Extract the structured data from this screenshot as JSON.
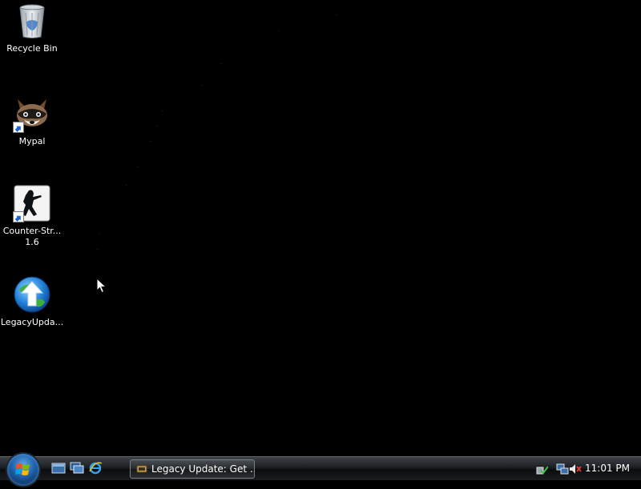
{
  "desktop": {
    "icons": [
      {
        "label": "Recycle Bin",
        "icon": "recycle-bin-icon"
      },
      {
        "label": "Mypal",
        "icon": "mypal-icon"
      },
      {
        "label": "Counter-Str...\n1.6",
        "icon": "counter-strike-icon"
      },
      {
        "label": "LegacyUpda...",
        "icon": "legacy-update-icon"
      }
    ]
  },
  "taskbar": {
    "start_icon": "windows-start-orb",
    "quick_launch": [
      "show-desktop-icon",
      "switch-windows-icon",
      "internet-explorer-icon"
    ],
    "tasks": [
      {
        "label": "Legacy Update: Get ...",
        "icon": "legacy-update-task-icon"
      }
    ],
    "tray": {
      "icons": [
        "safely-remove-hardware-icon",
        "network-icon",
        "volume-muted-icon"
      ],
      "clock": "11:01 PM"
    }
  },
  "colors": {
    "desktop_bg": "#000000",
    "taskbar_bg": "#1c1f22",
    "start_orb": "#1e5fa8"
  }
}
